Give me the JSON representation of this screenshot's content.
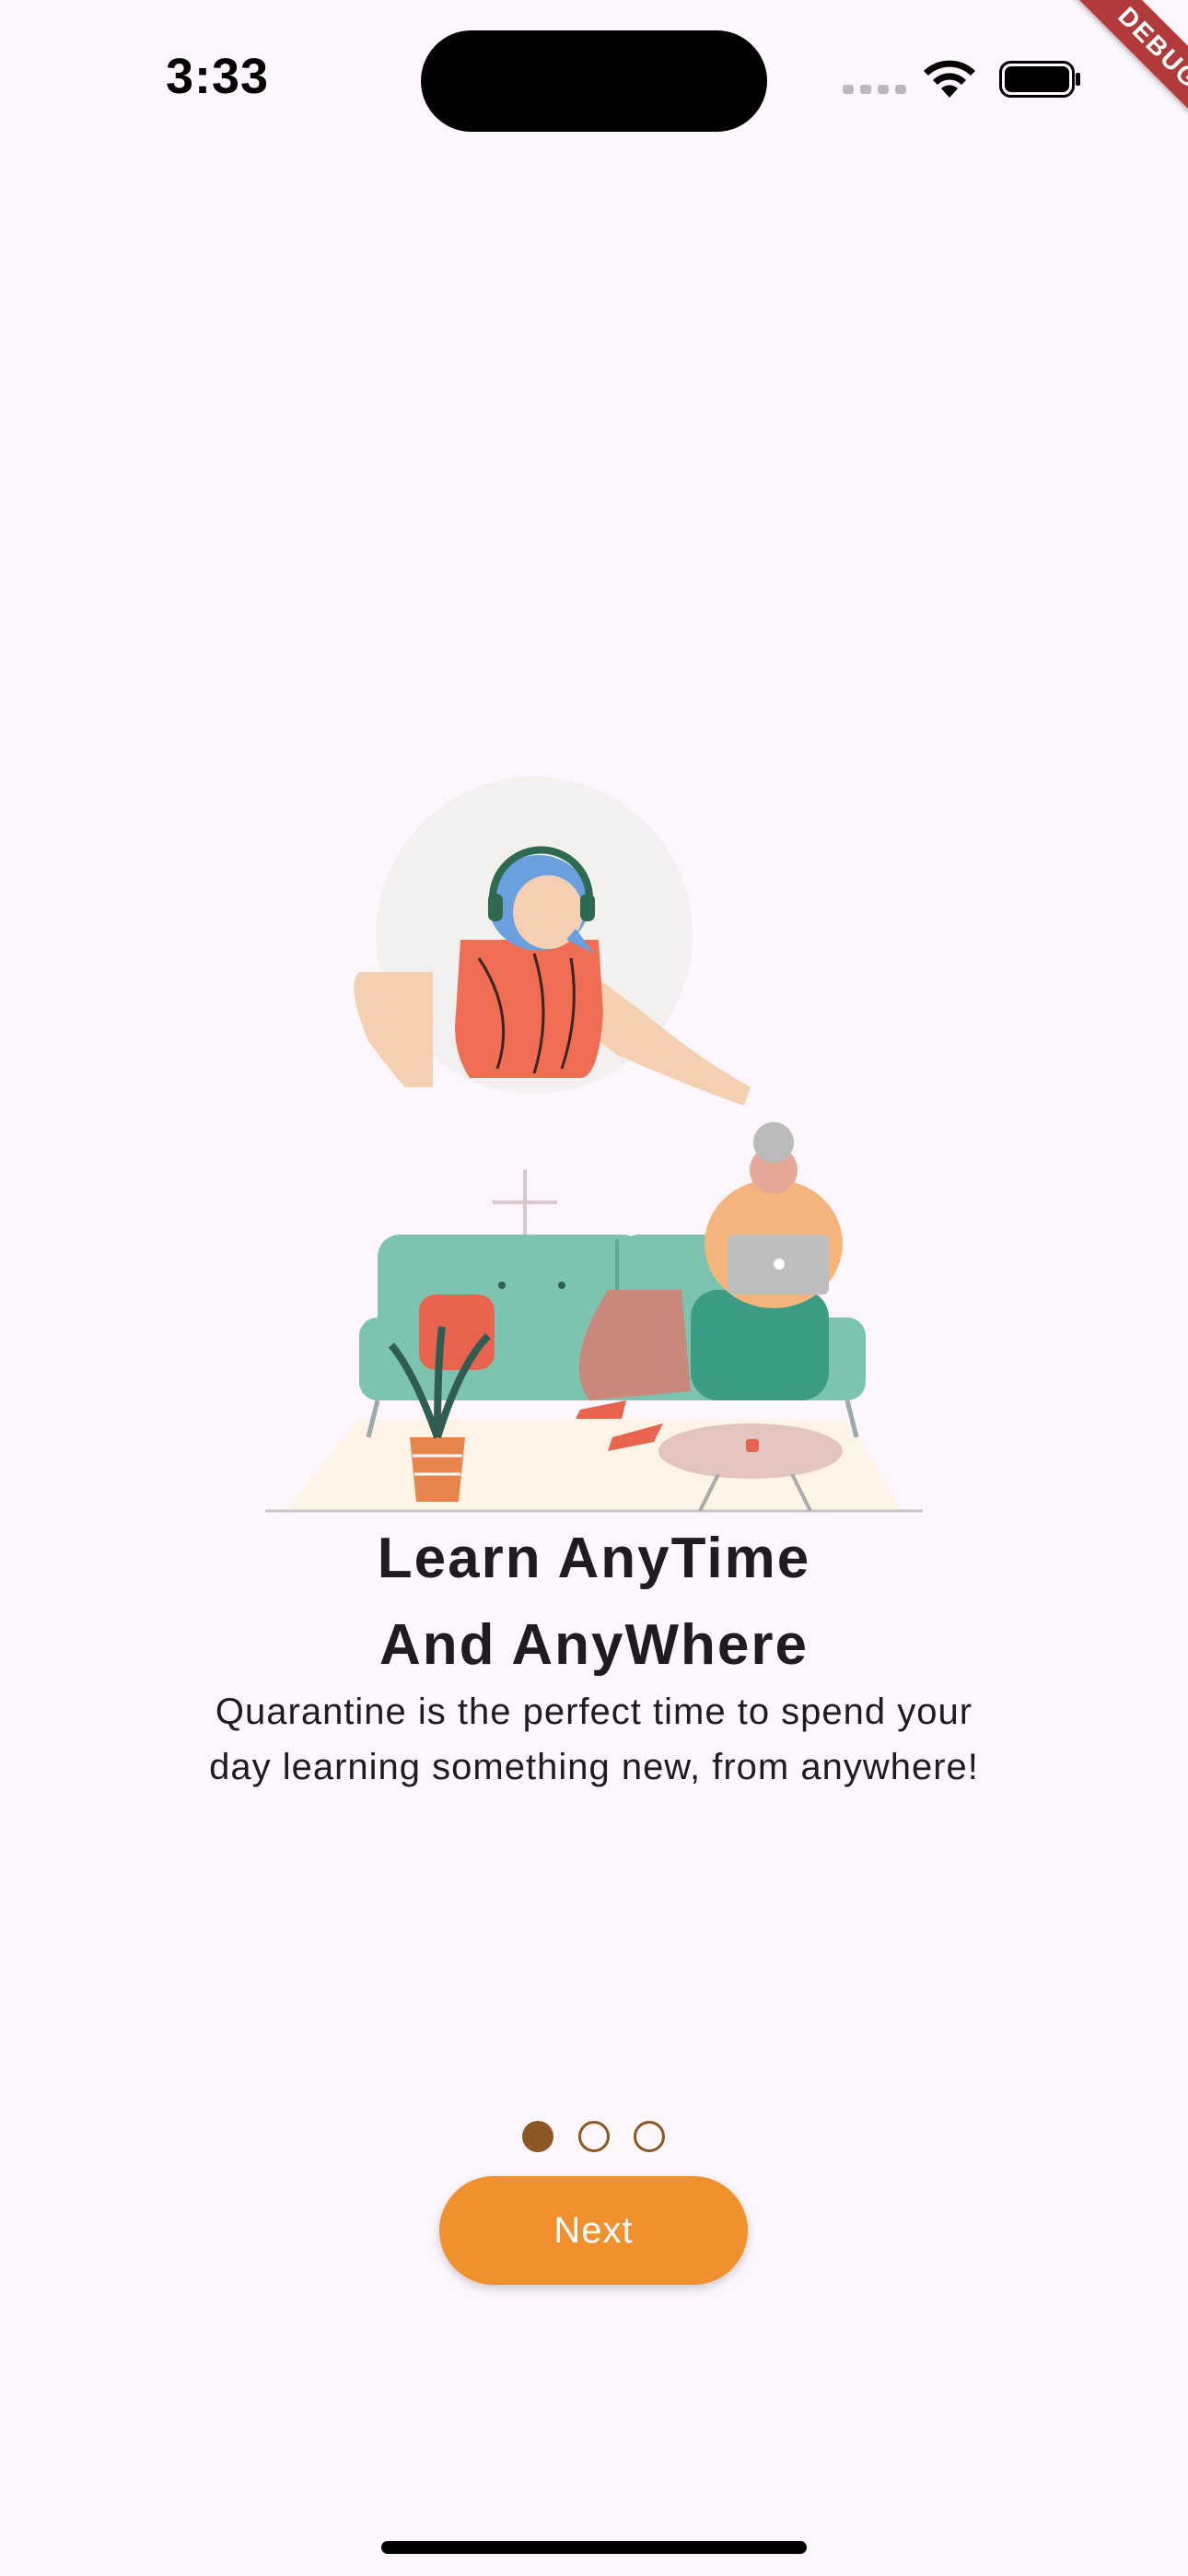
{
  "status_bar": {
    "time": "3:33",
    "debug_banner": "DEBUG"
  },
  "illustration": {
    "icon": "person-relaxing-on-couch-illustration"
  },
  "onboarding": {
    "title_line1": "Learn AnyTime",
    "title_line2": "And AnyWhere",
    "subtitle_line1": "Quarantine is the perfect time to spend your",
    "subtitle_line2": "day learning something new, from anywhere!"
  },
  "pager": {
    "total_pages": 3,
    "current_page": 1
  },
  "actions": {
    "next_label": "Next"
  },
  "colors": {
    "background": "#fdf6fc",
    "accent": "#f0912e",
    "indicator": "#8b5723",
    "text": "#1e1b22"
  }
}
